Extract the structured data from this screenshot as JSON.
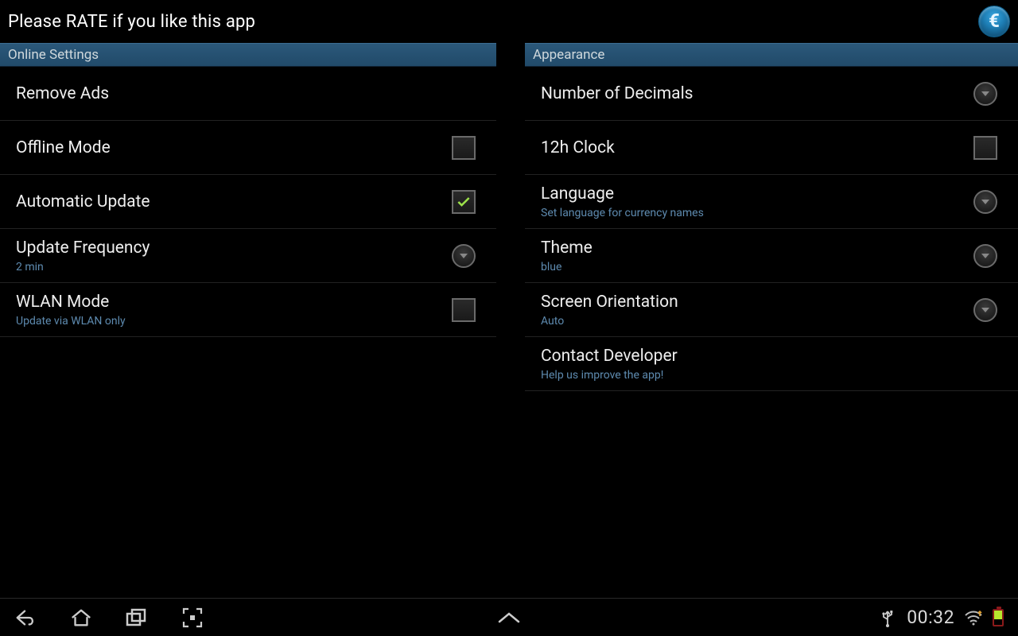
{
  "topbar": {
    "title": "Please RATE if you like this app"
  },
  "sections": {
    "online": {
      "header": "Online Settings",
      "remove_ads": "Remove Ads",
      "offline_mode": "Offline Mode",
      "automatic_update": "Automatic Update",
      "update_frequency": {
        "title": "Update Frequency",
        "value": "2 min"
      },
      "wlan_mode": {
        "title": "WLAN Mode",
        "sub": "Update via WLAN only"
      }
    },
    "appearance": {
      "header": "Appearance",
      "decimals": "Number of Decimals",
      "clock12h": "12h Clock",
      "language": {
        "title": "Language",
        "sub": "Set language for currency names"
      },
      "theme": {
        "title": "Theme",
        "value": "blue"
      },
      "orientation": {
        "title": "Screen Orientation",
        "value": "Auto"
      },
      "contact": {
        "title": "Contact Developer",
        "sub": "Help us improve the app!"
      }
    }
  },
  "state": {
    "offline_mode_checked": false,
    "automatic_update_checked": true,
    "clock12h_checked": false,
    "wlan_mode_checked": false
  },
  "navbar": {
    "clock": "00:32"
  }
}
